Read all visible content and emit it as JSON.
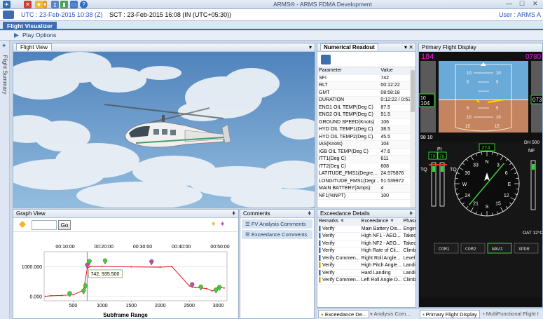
{
  "app": {
    "title": "ARMS® - ARMS FDMA Development"
  },
  "header": {
    "utc": "UTC :  23-Feb-2015 10:38  (Z)",
    "sct": "SCT :  23-Feb-2015 16:08  (IN (UTC+05:30))",
    "user": "User :  ARMS A"
  },
  "tabs": {
    "active": "Flight Visualizer"
  },
  "ribbon": {
    "play_options": "Play Options"
  },
  "left_rail": {
    "label": "Flight Summary"
  },
  "flight_view": {
    "tab": "Flight View"
  },
  "numerical": {
    "tab": "Numerical Readout",
    "columns": [
      "Parameter",
      "Value"
    ],
    "rows": [
      [
        "SFI",
        "742"
      ],
      [
        "RLT",
        "00:12:22"
      ],
      [
        "GMT",
        "08:58:18"
      ],
      [
        "DURATION",
        "0:12:22 / 0:53"
      ],
      [
        "ENG1 OIL TEMP(Deg C)",
        "87.5"
      ],
      [
        "ENG2 OIL TEMP(Deg C)",
        "91.5"
      ],
      [
        "GROUND SPEED(Knots)",
        "106"
      ],
      [
        "HYD OIL TEMP1(Deg C)",
        "38.5"
      ],
      [
        "HYD OIL TEMP2(Deg C)",
        "45.5"
      ],
      [
        "IAS(Knots)",
        "104"
      ],
      [
        "IGB OIL TEMP(Deg C)",
        "47.6"
      ],
      [
        "ITT1(Deg C)",
        "611"
      ],
      [
        "ITT2(Deg C)",
        "608"
      ],
      [
        "LATITUDE_FMS1(Degre...",
        "24.575876"
      ],
      [
        "LONGITUDE_FMS1(Degr...",
        "51.539972"
      ],
      [
        "MAIN BATTERY(Amps)",
        "4"
      ],
      [
        "NF1(%NPT)",
        "100"
      ]
    ]
  },
  "graph_view": {
    "title": "Graph View",
    "go": "Go",
    "tooltip": "742, 935.500",
    "xlabel": "Subframe Range"
  },
  "chart_data": {
    "type": "line",
    "title": "",
    "xlabel": "Subframe Range",
    "ylabel": "",
    "x_ticks": [
      "500",
      "1000",
      "1500",
      "2000",
      "2500",
      "3000"
    ],
    "y_ticks": [
      "0.000",
      "1000.000"
    ],
    "top_ticks": [
      "00:10:00",
      "00:20:00",
      "00:30:00",
      "00:40:00",
      "00:50:00"
    ],
    "xlim": [
      0,
      3150
    ],
    "ylim": [
      -150,
      1500
    ],
    "series": [
      {
        "x": [
          20,
          120,
          300,
          500,
          680,
          742,
          790,
          1000,
          1500,
          2000,
          2200,
          2500,
          2600,
          2800,
          2900,
          3000,
          3100
        ],
        "y": [
          0,
          20,
          30,
          50,
          200,
          935.5,
          1000,
          1000,
          990,
          980,
          1000,
          350,
          300,
          260,
          180,
          300,
          280
        ]
      }
    ],
    "markers": [
      {
        "x": 440,
        "y": -20,
        "color": "#44cc33"
      },
      {
        "x": 680,
        "y": 70,
        "color": "#44cc33"
      },
      {
        "x": 712,
        "y": 240,
        "color": "#44cc33"
      },
      {
        "x": 742,
        "y": 935.5,
        "color": "#c0509a"
      },
      {
        "x": 780,
        "y": 1060,
        "color": "#44cc33"
      },
      {
        "x": 1050,
        "y": 1080,
        "color": "#44cc33"
      },
      {
        "x": 1850,
        "y": 1050,
        "color": "#c0509a"
      },
      {
        "x": 2550,
        "y": 280,
        "color": "#c0509a"
      },
      {
        "x": 2700,
        "y": 200,
        "color": "#44cc33"
      },
      {
        "x": 2960,
        "y": 100,
        "color": "#44cc33"
      },
      {
        "x": 3020,
        "y": 190,
        "color": "#44cc33"
      }
    ]
  },
  "comments": {
    "title": "Comments",
    "items": [
      "FV Analysis Comments",
      "Exceedance Comments"
    ]
  },
  "exceedance": {
    "title": "Exceedance Details",
    "columns": [
      "Remarks",
      "Exceedance",
      "Phase"
    ],
    "rows": [
      [
        "Verify",
        "Main Battery Dis...",
        "Engin"
      ],
      [
        "Verify",
        "High NF1 - AEO...",
        "Takec"
      ],
      [
        "Verify",
        "High NF2 - AEO...",
        "Takec"
      ],
      [
        "Verify",
        "High Rate of Cli...",
        "Climb"
      ],
      [
        "Verify Commen...",
        "Right Roll Angle...",
        "Level"
      ],
      [
        "Verify",
        "High Pitch Angle...",
        "Landi"
      ],
      [
        "Verify",
        "Hard Landing",
        "Landi"
      ],
      [
        "Verify Commen...",
        "Left Roll Angle D...",
        "Climb"
      ]
    ]
  },
  "bottom_tabs": {
    "tab1": "Exceedance De...",
    "tab2": "Analysis Com...",
    "tab3": "Primary Flight Display",
    "tab4": "MultiFunctional Flight I"
  },
  "pfd": {
    "title": "Primary Flight Display",
    "speed_top": "184",
    "alt_top": "0780",
    "speed_box_a": "10",
    "speed_box_b": "104",
    "alt_box": "073",
    "left_bottom": "98 10",
    "pitch": [
      "10",
      "5",
      "5",
      "10",
      "15"
    ],
    "pi_label": "PI",
    "pi_vals": [
      "79",
      "78"
    ],
    "tq_a": "TQ",
    "tq_b": "TQ",
    "heading_box": "274",
    "dh": "DH  500",
    "nf": "NF",
    "nav": [
      "COM1",
      "COM2",
      "NAV1",
      "XPDR"
    ],
    "oat": "OAT 12°C",
    "compass": [
      "N",
      "E",
      "S",
      "W",
      "3",
      "6",
      "12",
      "15",
      "21",
      "24",
      "30",
      "33"
    ]
  },
  "colors": {
    "accent": "#3d6fb0",
    "utc_text": "#2b55c4",
    "sky": "#6aaad8",
    "ground": "#c58460",
    "pfd_bg": "#111111",
    "green": "#35d235",
    "magenta": "#e01bd9",
    "cyan": "#00d7e8",
    "series": "#e8242a"
  }
}
